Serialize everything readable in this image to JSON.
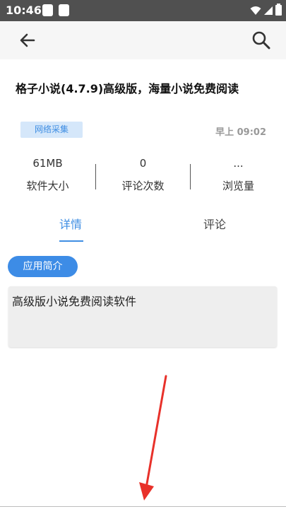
{
  "status_bar": {
    "time": "10:46"
  },
  "article": {
    "title": "格子小说(4.7.9)高级版，海量小说免费阅读",
    "source_tag": "网络采集",
    "time": "早上 09:02"
  },
  "stats": [
    {
      "value": "61MB",
      "label": "软件大小"
    },
    {
      "value": "0",
      "label": "评论次数"
    },
    {
      "value": "...",
      "label": "浏览量"
    }
  ],
  "tabs": [
    {
      "label": "详情",
      "active": true
    },
    {
      "label": "评论",
      "active": false
    }
  ],
  "section": {
    "title": "应用简介",
    "text": "高级版小说免费阅读软件"
  },
  "colors": {
    "accent": "#3f8ee3",
    "status_bar": "#505050",
    "annotation_arrow": "#e8312a"
  }
}
